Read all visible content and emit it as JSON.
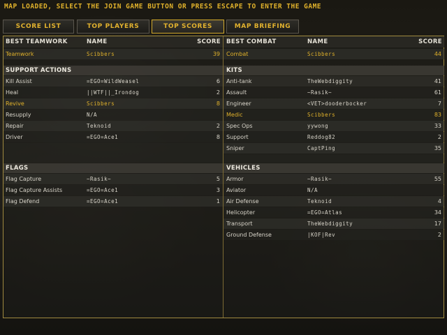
{
  "status_message": "MAP LOADED, SELECT THE JOIN GAME BUTTON OR PRESS ESCAPE TO ENTER THE GAME",
  "tabs": [
    {
      "label": "SCORE LIST"
    },
    {
      "label": "TOP PLAYERS"
    },
    {
      "label": "TOP SCORES",
      "active": true
    },
    {
      "label": "MAP BRIEFING"
    }
  ],
  "columns": {
    "name": "NAME",
    "score": "SCORE"
  },
  "left": {
    "header": "BEST TEAMWORK",
    "best": {
      "category": "Teamwork",
      "name": "Scibbers",
      "score": "39"
    },
    "support": {
      "title": "SUPPORT ACTIONS",
      "rows": [
        {
          "category": "Kill Assist",
          "name": "=EGO=WildWeasel",
          "score": "6"
        },
        {
          "category": "Heal",
          "name": "||WTF||_Irondog",
          "score": "2"
        },
        {
          "category": "Revive",
          "name": "Scibbers",
          "score": "8"
        },
        {
          "category": "Resupply",
          "name": "N/A",
          "score": ""
        },
        {
          "category": "Repair",
          "name": "Teknoid",
          "score": "2"
        },
        {
          "category": "Driver",
          "name": "=EGO=Ace1",
          "score": "8"
        }
      ]
    },
    "flags": {
      "title": "FLAGS",
      "rows": [
        {
          "category": "Flag Capture",
          "name": "~Rasik~",
          "score": "5"
        },
        {
          "category": "Flag Capture Assists",
          "name": "=EGO=Ace1",
          "score": "3"
        },
        {
          "category": "Flag Defend",
          "name": "=EGO=Ace1",
          "score": "1"
        }
      ]
    }
  },
  "right": {
    "header": "BEST COMBAT",
    "best": {
      "category": "Combat",
      "name": "Scibbers",
      "score": "44"
    },
    "kits": {
      "title": "KITS",
      "rows": [
        {
          "category": "Anti-tank",
          "name": "TheWebdiggity",
          "score": "41"
        },
        {
          "category": "Assault",
          "name": "~Rasik~",
          "score": "61"
        },
        {
          "category": "Engineer",
          "name": "<VET>dooderbocker",
          "score": "7"
        },
        {
          "category": "Medic",
          "name": "Scibbers",
          "score": "83"
        },
        {
          "category": "Spec Ops",
          "name": "yywong",
          "score": "33"
        },
        {
          "category": "Support",
          "name": "Reddog82",
          "score": "2"
        },
        {
          "category": "Sniper",
          "name": "CaptPing",
          "score": "35"
        }
      ]
    },
    "vehicles": {
      "title": "VEHICLES",
      "rows": [
        {
          "category": "Armor",
          "name": "~Rasik~",
          "score": "55"
        },
        {
          "category": "Aviator",
          "name": "N/A",
          "score": ""
        },
        {
          "category": "Air Defense",
          "name": "Teknoid",
          "score": "4"
        },
        {
          "category": "Helicopter",
          "name": "=EGO=Atlas",
          "score": "34"
        },
        {
          "category": "Transport",
          "name": "TheWebdiggity",
          "score": "17"
        },
        {
          "category": "Ground Defense",
          "name": "|KOF|Rev",
          "score": "2"
        }
      ]
    }
  },
  "colors": {
    "accent": "#e0b12b",
    "border": "#a08a3f",
    "text": "#d8d4c9"
  }
}
